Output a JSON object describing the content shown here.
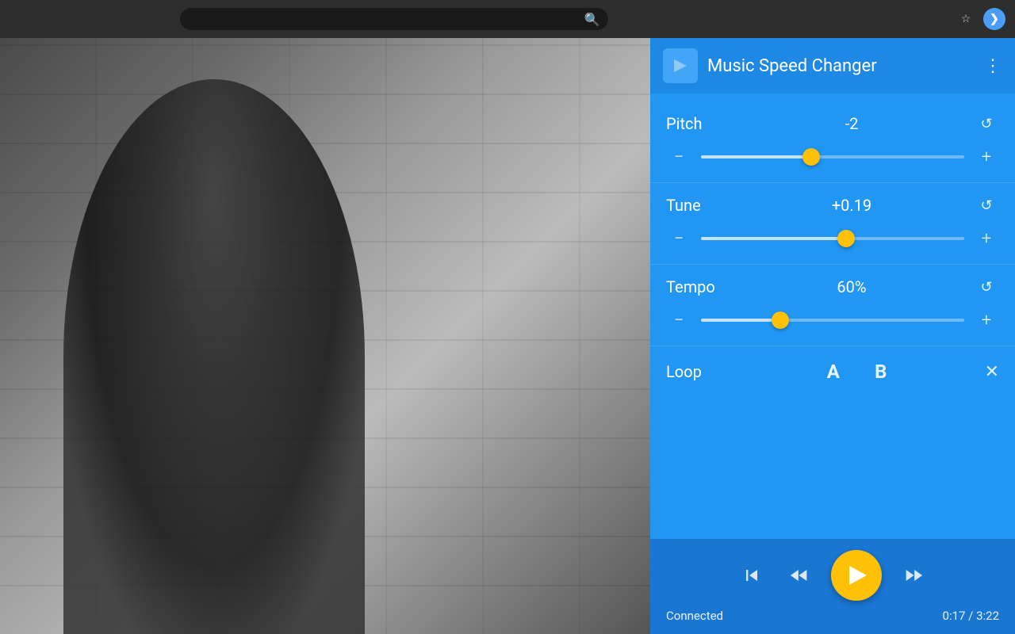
{
  "browser": {
    "star_icon": "☆",
    "forward_icon": "❯"
  },
  "panel": {
    "header": {
      "title": "Music Speed Changer",
      "menu_icon": "⋮"
    },
    "pitch": {
      "label": "Pitch",
      "value": "-2",
      "reset_icon": "↺",
      "minus_label": "−",
      "plus_label": "+",
      "thumb_percent": 42
    },
    "tune": {
      "label": "Tune",
      "value": "+0.19",
      "reset_icon": "↺",
      "minus_label": "−",
      "plus_label": "+",
      "thumb_percent": 55
    },
    "tempo": {
      "label": "Tempo",
      "value": "60%",
      "reset_icon": "↺",
      "minus_label": "−",
      "plus_label": "+",
      "thumb_percent": 30
    },
    "loop": {
      "label": "Loop",
      "a_label": "A",
      "b_label": "B",
      "close_icon": "✕"
    },
    "player": {
      "skip_back_icon": "⏮",
      "rewind_icon": "⏪",
      "fast_forward_icon": "⏩",
      "status": "Connected",
      "time": "0:17 / 3:22"
    }
  }
}
